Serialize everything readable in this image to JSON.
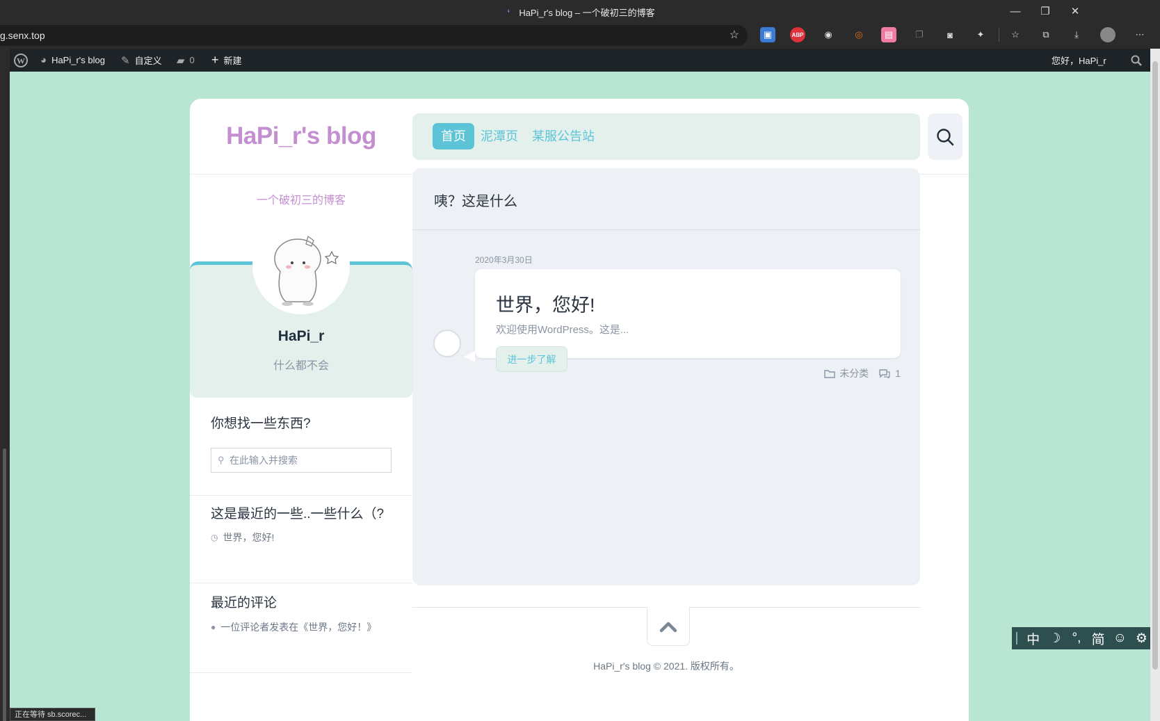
{
  "browser": {
    "window_title": "HaPi_r's blog – 一个破初三的博客",
    "url": "g.senx.top",
    "status_text": "正在等待 sb.scorec..."
  },
  "adminbar": {
    "site_name": "HaPi_r's blog",
    "customize": "自定义",
    "comments_count": "0",
    "new_label": "新建",
    "greeting": "您好，HaPi_r"
  },
  "site": {
    "title": "HaPi_r's blog",
    "description": "一个破初三的博客"
  },
  "nav": {
    "items": [
      {
        "label": "首页",
        "active": true
      },
      {
        "label": "泥潭页",
        "active": false
      },
      {
        "label": "某服公告站",
        "active": false
      }
    ]
  },
  "profile": {
    "name": "HaPi_r",
    "bio": "什么都不会"
  },
  "widgets": {
    "search_title": "你想找一些东西?",
    "search_placeholder": "在此输入并搜索",
    "recent_title": "这是最近的一些..一些什么（?",
    "recent_item": "世界，您好!",
    "comments_title": "最近的评论",
    "comment_item": "一位评论者发表在《世界，您好！》"
  },
  "main": {
    "heading": "咦？这是什么",
    "post": {
      "date": "2020年3月30日",
      "title": "世界，您好!",
      "excerpt": "欢迎使用WordPress。这是...",
      "more": "进一步了解",
      "category": "未分类",
      "comments": "1"
    }
  },
  "footer": {
    "copyright": "HaPi_r's blog © 2021. 版权所有。"
  },
  "ime": {
    "mode": "中",
    "moon": "☽",
    "punct": "°,",
    "simp": "简",
    "smile": "☺",
    "gear": "⚙"
  },
  "colors": {
    "page_bg": "#b8e6d3",
    "accent": "#5cc4d6",
    "title_purple": "#c48fd0"
  }
}
